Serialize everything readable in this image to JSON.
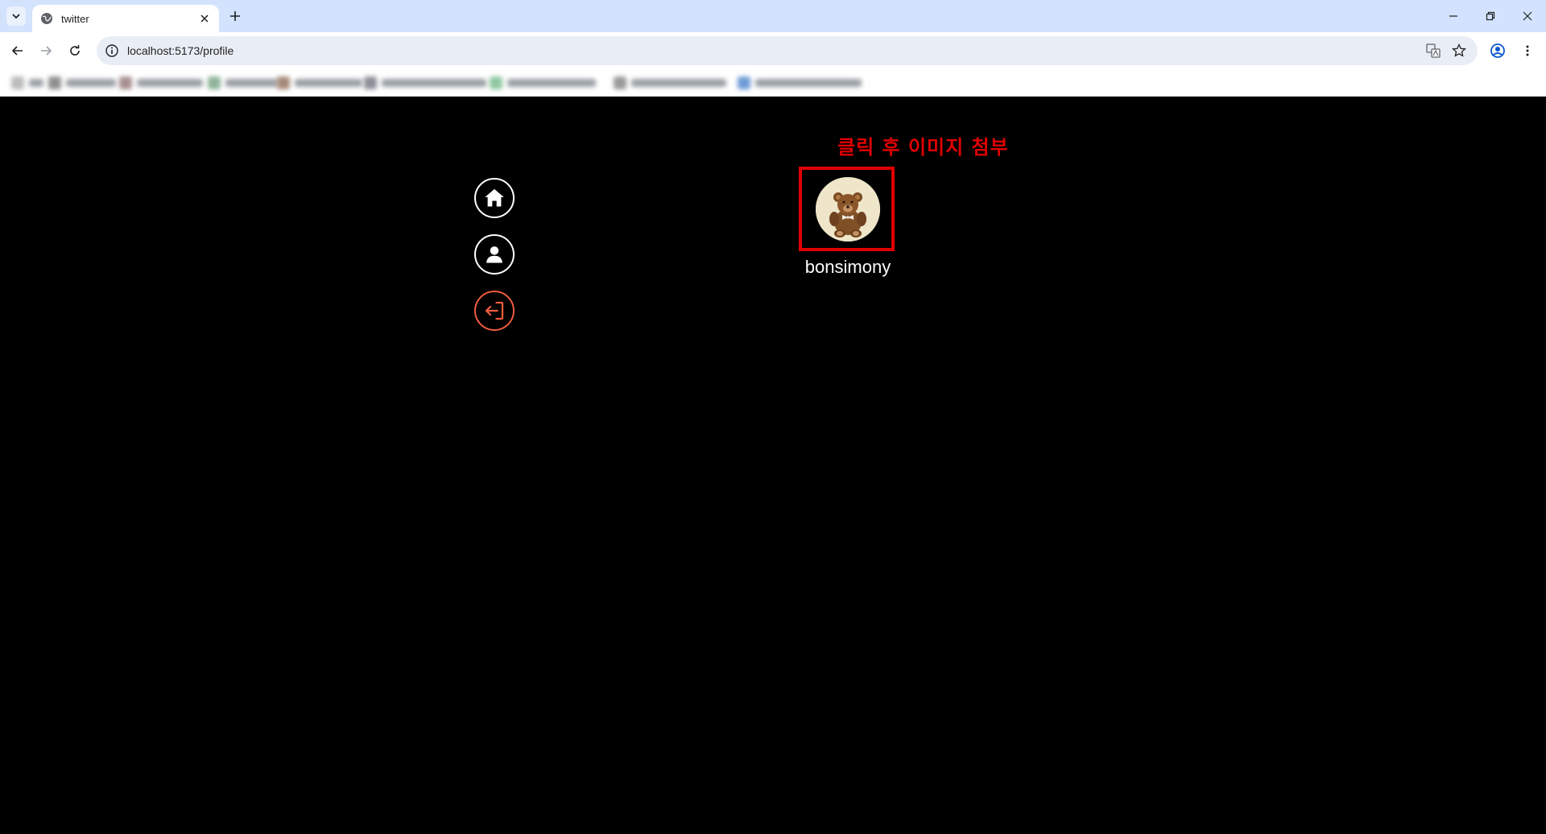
{
  "browser": {
    "tab": {
      "title": "twitter"
    },
    "address_bar": {
      "url": "localhost:5173/profile"
    }
  },
  "colors": {
    "page_background": "#000000",
    "annotation_red": "#e00000",
    "logout_accent": "#f05b3f",
    "tabstrip": "#d3e3fd"
  },
  "sidebar": {
    "items": [
      {
        "name": "home",
        "icon": "home-icon"
      },
      {
        "name": "profile",
        "icon": "user-icon"
      },
      {
        "name": "logout",
        "icon": "logout-icon"
      }
    ]
  },
  "annotation": {
    "text": "클릭 후 이미지 첨부"
  },
  "profile": {
    "avatar_icon": "teddy-bear-avatar",
    "username": "bonsimony"
  }
}
